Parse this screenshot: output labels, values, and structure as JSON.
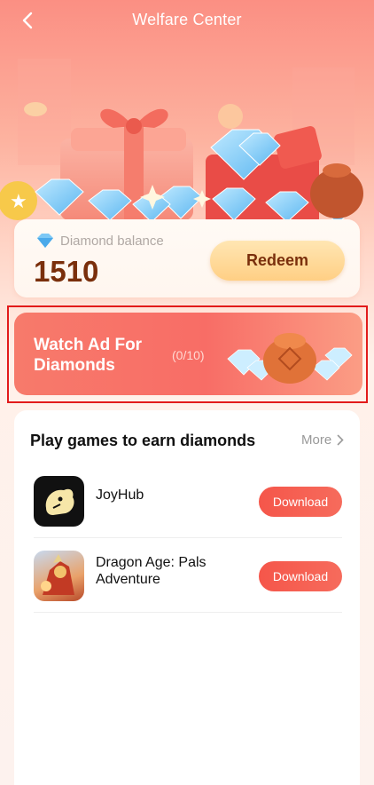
{
  "header": {
    "title": "Welfare Center"
  },
  "balance": {
    "label": "Diamond balance",
    "value": "1510",
    "redeem_label": "Redeem"
  },
  "ad_banner": {
    "title": "Watch Ad For Diamonds",
    "count": "(0/10)"
  },
  "games": {
    "section_title": "Play games to earn diamonds",
    "more_label": "More",
    "items": [
      {
        "name": "JoyHub",
        "button": "Download"
      },
      {
        "name": "Dragon Age: Pals Adventure",
        "button": "Download"
      }
    ]
  },
  "colors": {
    "accent": "#f5564a",
    "balance_text": "#7a2f0c",
    "banner": "#f77a6b"
  }
}
